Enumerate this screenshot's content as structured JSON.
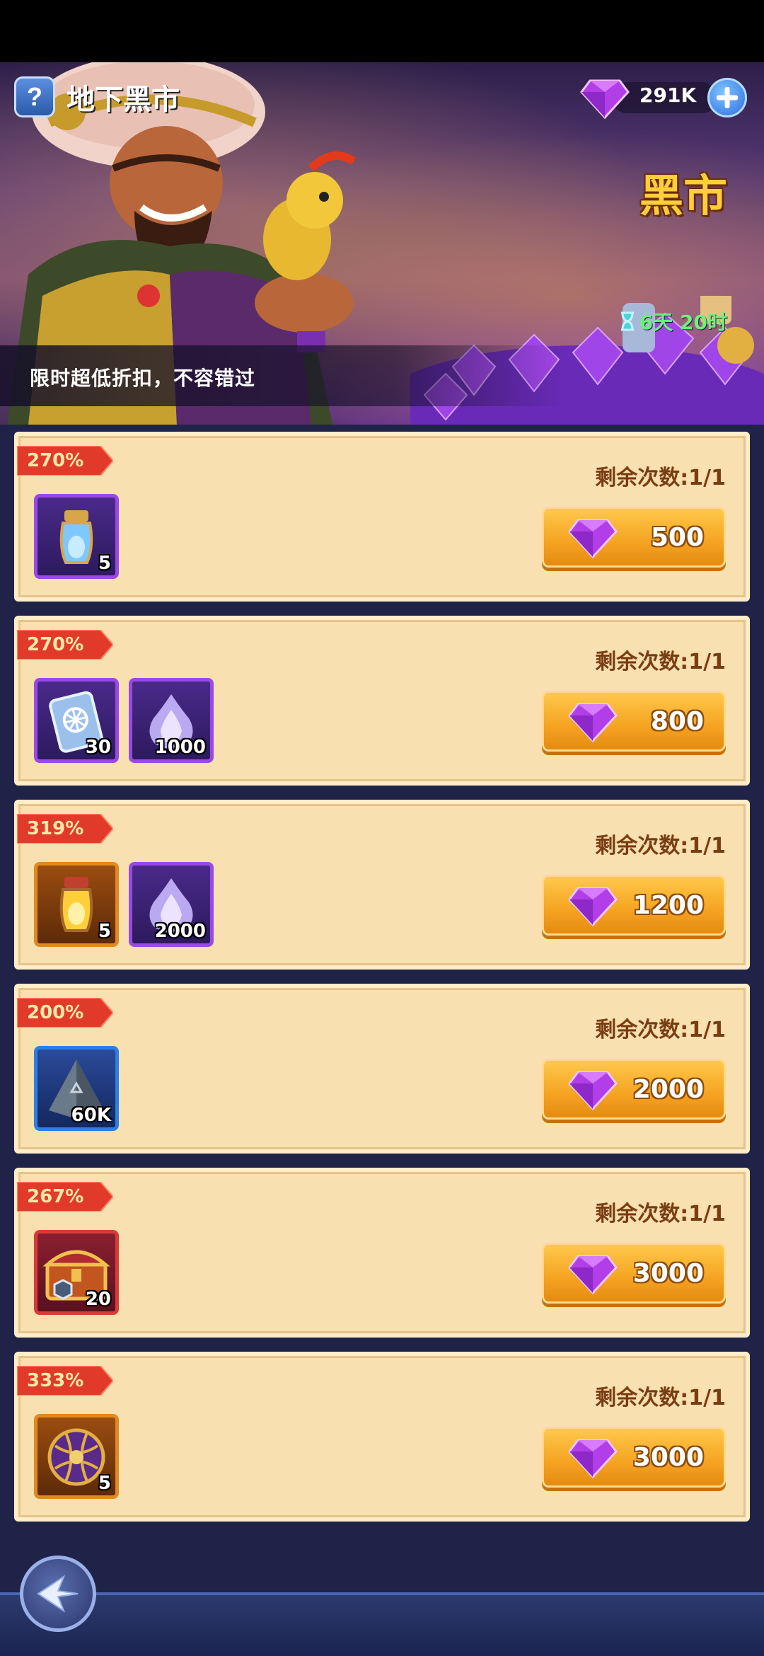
{
  "header": {
    "title": "地下黑市",
    "help_icon": "question-icon",
    "currency": {
      "icon": "gem-icon",
      "value": "291K"
    }
  },
  "banner": {
    "market_title": "黑市",
    "timer": "6天 20时",
    "tagline": "限时超低折扣，不容错过"
  },
  "offers": [
    {
      "discount": "270%",
      "remaining": "剩余次数:1/1",
      "price": "500",
      "items": [
        {
          "icon": "blue-potion-icon",
          "qty": "5",
          "frame": "purple"
        }
      ]
    },
    {
      "discount": "270%",
      "remaining": "剩余次数:1/1",
      "price": "800",
      "items": [
        {
          "icon": "ticket-icon",
          "qty": "30",
          "frame": "purple"
        },
        {
          "icon": "soul-flame-icon",
          "qty": "1000",
          "frame": "purple"
        }
      ]
    },
    {
      "discount": "319%",
      "remaining": "剩余次数:1/1",
      "price": "1200",
      "items": [
        {
          "icon": "gold-potion-icon",
          "qty": "5",
          "frame": "orange"
        },
        {
          "icon": "soul-flame-icon",
          "qty": "2000",
          "frame": "purple"
        }
      ]
    },
    {
      "discount": "200%",
      "remaining": "剩余次数:1/1",
      "price": "2000",
      "items": [
        {
          "icon": "pyramid-stone-icon",
          "qty": "60K",
          "frame": "blue"
        }
      ]
    },
    {
      "discount": "267%",
      "remaining": "剩余次数:1/1",
      "price": "3000",
      "items": [
        {
          "icon": "treasure-chest-icon",
          "qty": "20",
          "frame": "red"
        }
      ]
    },
    {
      "discount": "333%",
      "remaining": "剩余次数:1/1",
      "price": "3000",
      "items": [
        {
          "icon": "orb-icon",
          "qty": "5",
          "frame": "orange"
        }
      ]
    }
  ],
  "footer": {
    "back_icon": "back-arrow-icon"
  }
}
